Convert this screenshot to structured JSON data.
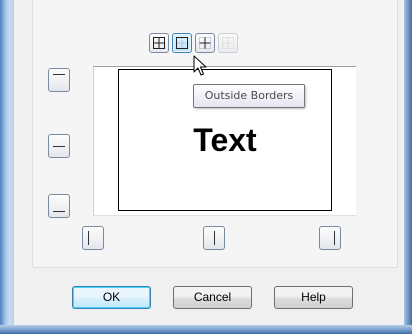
{
  "toolbar": {
    "buttons": [
      {
        "name": "all-borders",
        "icon": "all-borders-icon"
      },
      {
        "name": "outside-borders",
        "icon": "outside-borders-icon",
        "active": true
      },
      {
        "name": "inside-borders",
        "icon": "inside-borders-icon"
      },
      {
        "name": "no-borders",
        "icon": "no-borders-icon",
        "disabled": true
      }
    ]
  },
  "tooltip": {
    "text": "Outside Borders"
  },
  "preview": {
    "text": "Text"
  },
  "buttons": {
    "ok": "OK",
    "cancel": "Cancel",
    "help": "Help"
  },
  "colors": {
    "accent": "#3c7fb1",
    "window_frame": "#4f82bd",
    "dialog_bg": "#f0f0f0"
  }
}
